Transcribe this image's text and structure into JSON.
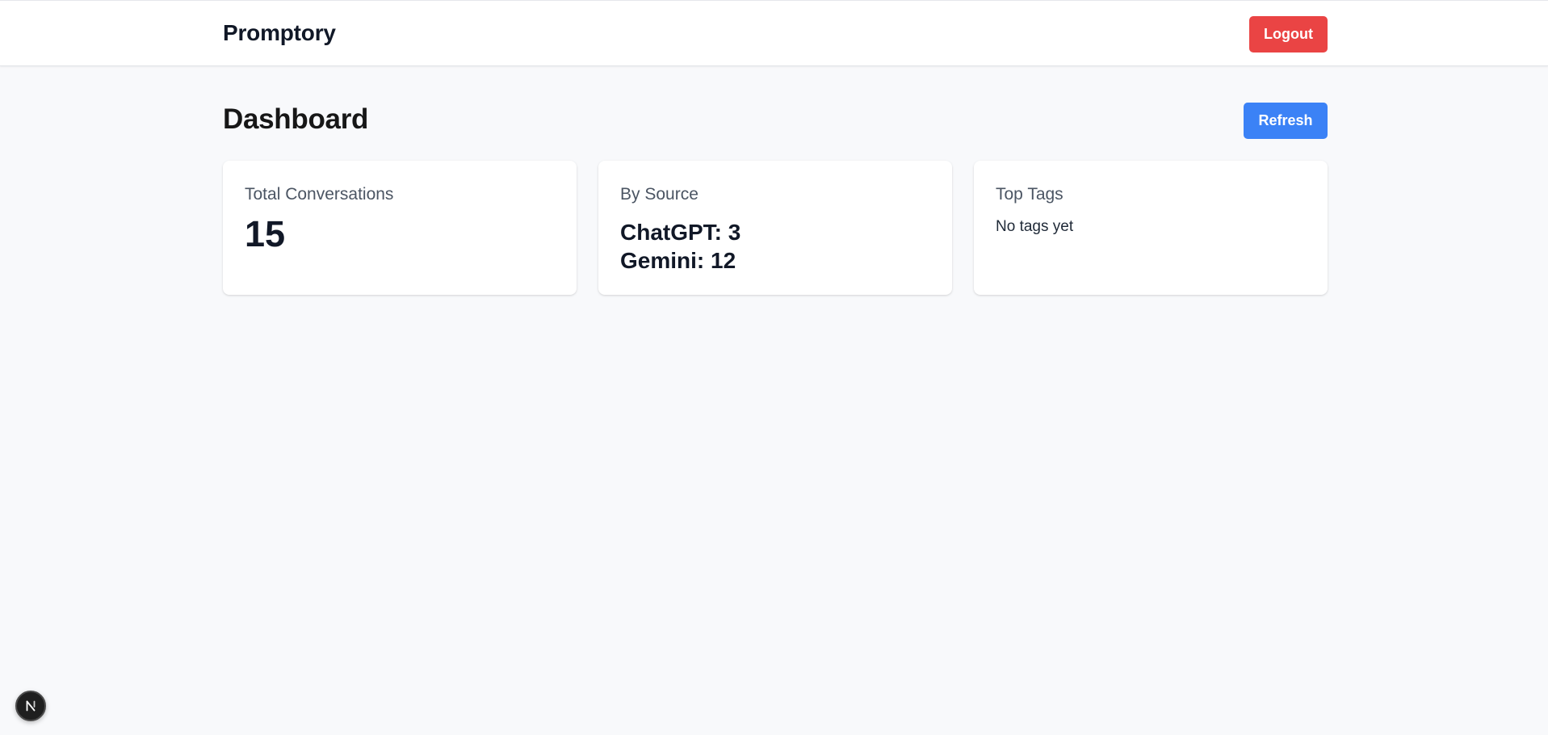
{
  "header": {
    "brand": "Promptory",
    "logout_label": "Logout"
  },
  "main": {
    "title": "Dashboard",
    "refresh_label": "Refresh"
  },
  "cards": {
    "total": {
      "title": "Total Conversations",
      "value": "15"
    },
    "source": {
      "title": "By Source",
      "items": [
        {
          "label": "ChatGPT: 3"
        },
        {
          "label": "Gemini: 12"
        }
      ]
    },
    "tags": {
      "title": "Top Tags",
      "empty": "No tags yet"
    }
  },
  "dev_badge": {
    "icon": "next-logo-icon"
  },
  "colors": {
    "background": "#f8f9fb",
    "logout": "#ea4444",
    "refresh": "#3b82f6"
  }
}
